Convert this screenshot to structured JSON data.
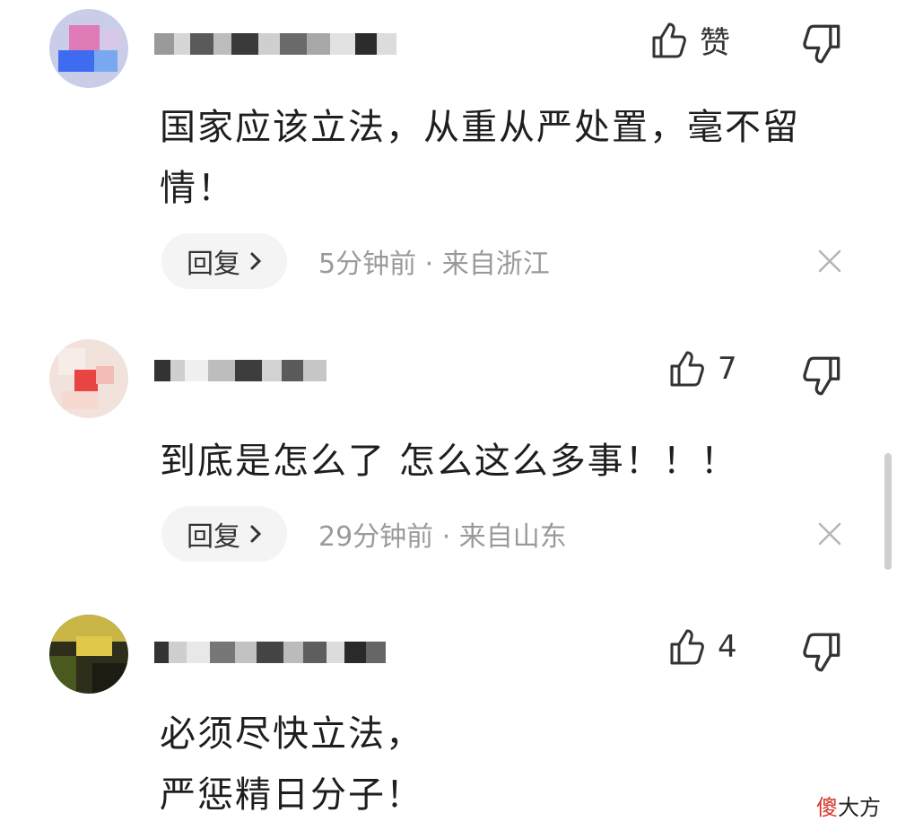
{
  "comments": [
    {
      "like_label": "赞",
      "content": "国家应该立法，从重从严处置，毫不留情！",
      "reply_label": "回复",
      "meta": "5分钟前 · 来自浙江"
    },
    {
      "like_label": "7",
      "content": "到底是怎么了 怎么这么多事！！！",
      "reply_label": "回复",
      "meta": "29分钟前 · 来自山东"
    },
    {
      "like_label": "4",
      "content_lines": [
        "必须尽快立法，",
        "严惩精日分子！"
      ]
    }
  ],
  "watermark": {
    "part1": "傻",
    "part2": "大方"
  },
  "icons": {
    "thumb_up": "thumb-up-icon",
    "thumb_down": "thumb-down-icon",
    "chevron": "chevron-right-icon",
    "close": "close-icon"
  },
  "colors": {
    "meta_text": "#9a9a9a",
    "reply_bg": "#f4f4f4",
    "watermark_accent": "#d9342b"
  }
}
